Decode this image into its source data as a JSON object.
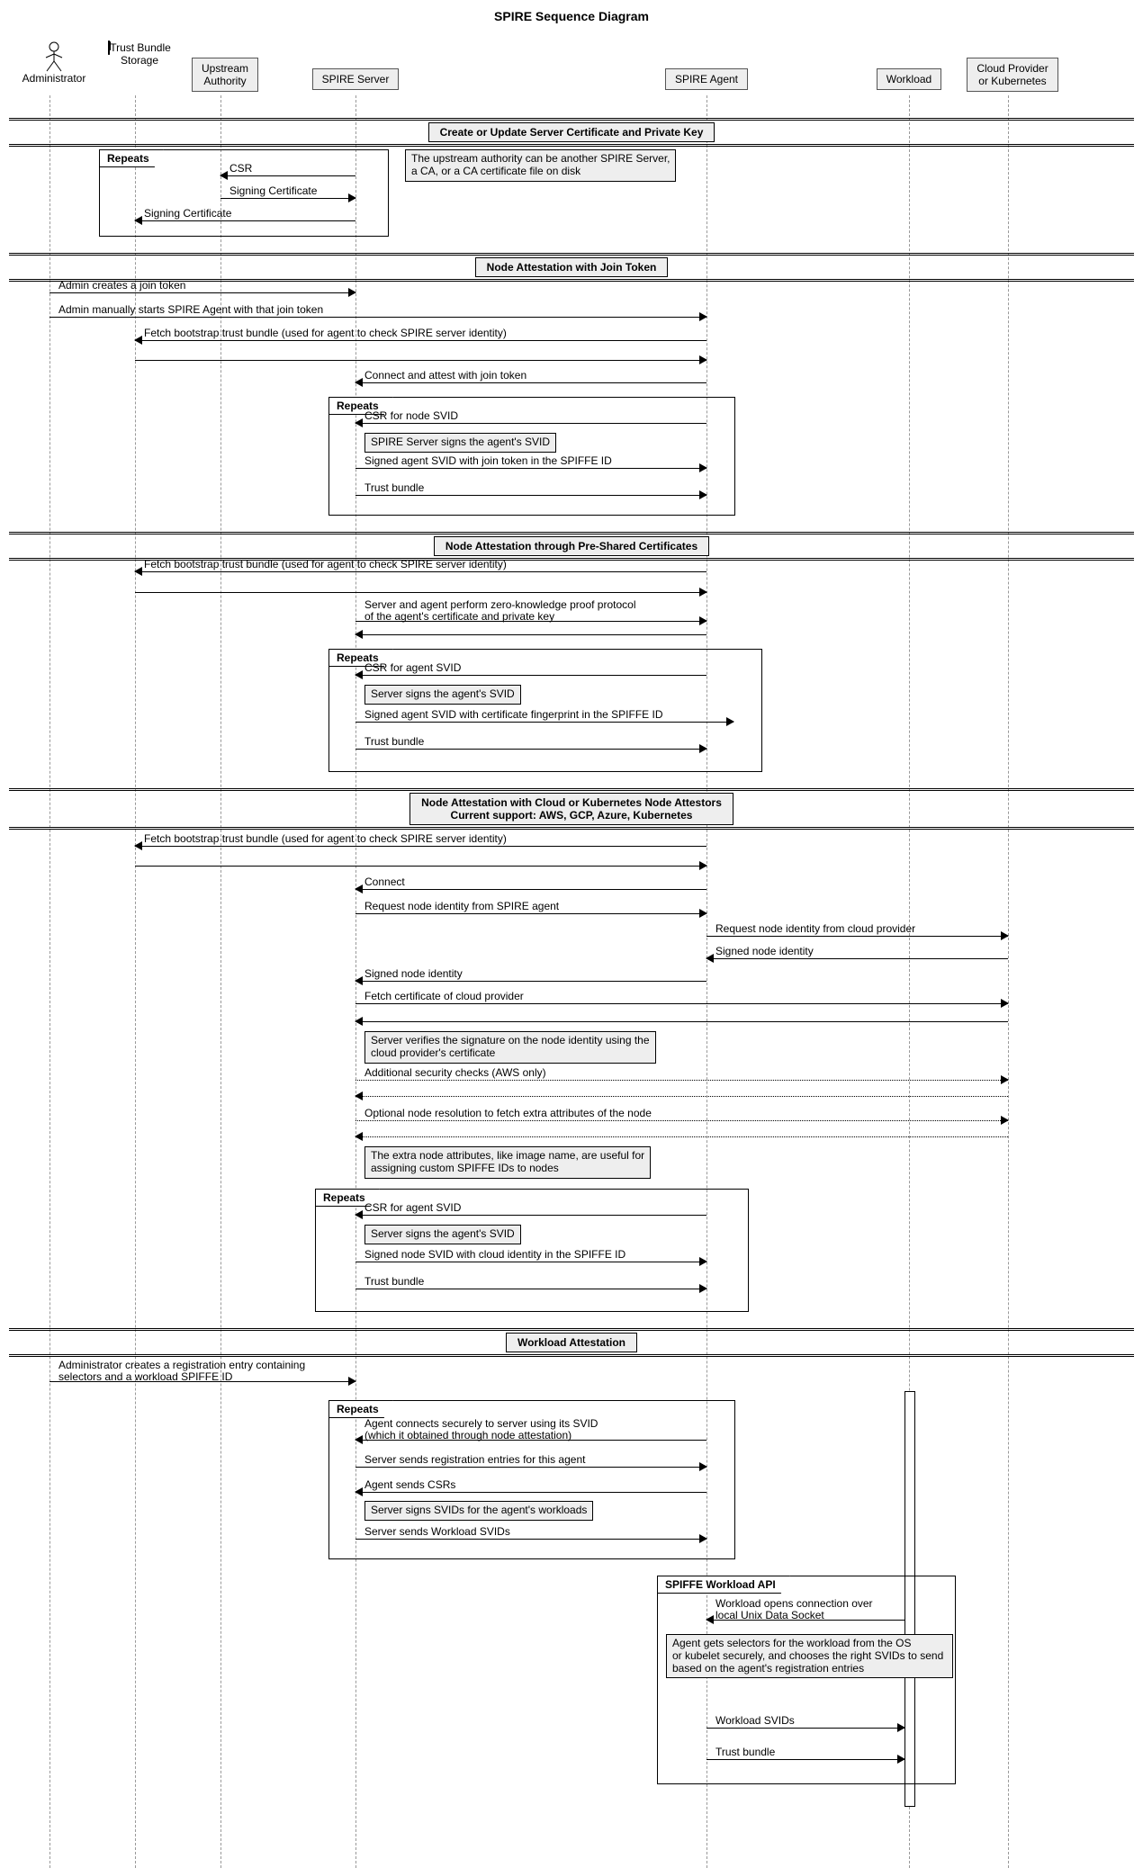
{
  "title": "SPIRE Sequence Diagram",
  "participants": {
    "admin": "Administrator",
    "storage": "Trust Bundle\nStorage",
    "upstream": "Upstream\nAuthority",
    "server": "SPIRE Server",
    "agent": "SPIRE Agent",
    "workload": "Workload",
    "cloud": "Cloud Provider\nor Kubernetes"
  },
  "sections": {
    "s1": "Create or Update Server Certificate and Private Key",
    "s2": "Node Attestation with Join Token",
    "s3": "Node Attestation through Pre-Shared Certificates",
    "s4": "Node Attestation with Cloud or Kubernetes Node Attestors\nCurrent support: AWS, GCP, Azure, Kubernetes",
    "s5": "Workload Attestation"
  },
  "loops": {
    "repeats": "Repeats",
    "spiffe_api": "SPIFFE Workload API"
  },
  "notes": {
    "upstream_note": "The upstream authority can be another SPIRE Server,\na CA, or a CA certificate file on disk",
    "sign_svid": "SPIRE Server signs the agent's SVID",
    "server_signs": "Server signs the agent's SVID",
    "verify_sig": "Server verifies the signature on the node identity using the\ncloud provider's certificate",
    "extra_attrs": "The extra node attributes, like image name, are useful for\nassigning custom SPIFFE IDs to nodes",
    "sign_workload": "Server signs SVIDs for the agent's workloads",
    "agent_selectors": "Agent gets selectors for the workload from the OS\nor kubelet securely, and chooses the right SVIDs to send\nbased on the agent's registration entries"
  },
  "messages": {
    "csr": "CSR",
    "signing_cert": "Signing Certificate",
    "signing_cert2": "Signing Certificate",
    "admin_join": "Admin creates a join token",
    "admin_start": "Admin manually starts SPIRE Agent with that join token",
    "fetch_bootstrap": "Fetch bootstrap trust bundle (used for agent to check SPIRE server identity)",
    "blank": " ",
    "connect_attest": "Connect and attest with join token",
    "csr_node": "CSR for node SVID",
    "signed_join": "Signed agent SVID with join token in the SPIFFE ID",
    "trust_bundle": "Trust bundle",
    "zero_knowledge": "Server and agent perform zero-knowledge proof protocol\nof the agent's certificate and private key",
    "csr_agent": "CSR for agent SVID",
    "signed_fp": "Signed agent SVID with certificate fingerprint in the SPIFFE ID",
    "connect": "Connect",
    "req_identity_agent": "Request node identity from SPIRE agent",
    "req_identity_cloud": "Request node identity from cloud provider",
    "signed_identity": "Signed node identity",
    "fetch_cloud_cert": "Fetch certificate of cloud provider",
    "addl_checks": "Additional security checks (AWS only)",
    "node_resolution": "Optional node resolution to fetch extra attributes of the node",
    "signed_cloud": "Signed node SVID with cloud identity in the SPIFFE ID",
    "admin_reg": "Administrator creates a registration entry containing\nselectors and a workload SPIFFE ID",
    "agent_connect": "Agent connects securely to server using its SVID\n(which it obtained through node attestation)",
    "server_reg": "Server sends registration entries for this agent",
    "agent_csrs": "Agent sends CSRs",
    "server_workload_svids": "Server sends Workload SVIDs",
    "workload_open": "Workload opens connection over\nlocal Unix Data Socket",
    "workload_svids": "Workload SVIDs",
    "trust_bundle2": "Trust bundle"
  },
  "chart_data": {
    "type": "sequence-diagram",
    "participants": [
      "Administrator",
      "Trust Bundle Storage",
      "Upstream Authority",
      "SPIRE Server",
      "SPIRE Agent",
      "Workload",
      "Cloud Provider or Kubernetes"
    ],
    "groups": [
      {
        "title": "Create or Update Server Certificate and Private Key",
        "loop": "Repeats",
        "note_right_of": {
          "participant": "SPIRE Server",
          "text": "The upstream authority can be another SPIRE Server, a CA, or a CA certificate file on disk"
        },
        "messages": [
          {
            "from": "SPIRE Server",
            "to": "Upstream Authority",
            "text": "CSR"
          },
          {
            "from": "Upstream Authority",
            "to": "SPIRE Server",
            "text": "Signing Certificate"
          },
          {
            "from": "SPIRE Server",
            "to": "Trust Bundle Storage",
            "text": "Signing Certificate"
          }
        ]
      },
      {
        "title": "Node Attestation with Join Token",
        "messages": [
          {
            "from": "Administrator",
            "to": "SPIRE Server",
            "text": "Admin creates a join token"
          },
          {
            "from": "Administrator",
            "to": "SPIRE Agent",
            "text": "Admin manually starts SPIRE Agent with that join token"
          },
          {
            "from": "SPIRE Agent",
            "to": "Trust Bundle Storage",
            "text": "Fetch bootstrap trust bundle (used for agent to check SPIRE server identity)"
          },
          {
            "from": "Trust Bundle Storage",
            "to": "SPIRE Agent",
            "text": ""
          },
          {
            "from": "SPIRE Agent",
            "to": "SPIRE Server",
            "text": "Connect and attest with join token"
          }
        ],
        "loop": {
          "label": "Repeats",
          "messages": [
            {
              "from": "SPIRE Agent",
              "to": "SPIRE Server",
              "text": "CSR for node SVID"
            },
            {
              "note_over": "SPIRE Server",
              "text": "SPIRE Server signs the agent's SVID"
            },
            {
              "from": "SPIRE Server",
              "to": "SPIRE Agent",
              "text": "Signed agent SVID with join token in the SPIFFE ID"
            },
            {
              "from": "SPIRE Server",
              "to": "SPIRE Agent",
              "text": "Trust bundle"
            }
          ]
        }
      },
      {
        "title": "Node Attestation through Pre-Shared Certificates",
        "messages": [
          {
            "from": "SPIRE Agent",
            "to": "Trust Bundle Storage",
            "text": "Fetch bootstrap trust bundle (used for agent to check SPIRE server identity)"
          },
          {
            "from": "Trust Bundle Storage",
            "to": "SPIRE Agent",
            "text": ""
          },
          {
            "from": "SPIRE Agent",
            "to": "SPIRE Server",
            "text": "Server and agent perform zero-knowledge proof protocol of the agent's certificate and private key",
            "bidirectional": true
          }
        ],
        "loop": {
          "label": "Repeats",
          "messages": [
            {
              "from": "SPIRE Agent",
              "to": "SPIRE Server",
              "text": "CSR for agent SVID"
            },
            {
              "note_over": "SPIRE Server",
              "text": "Server signs the agent's SVID"
            },
            {
              "from": "SPIRE Server",
              "to": "SPIRE Agent",
              "text": "Signed agent SVID with certificate fingerprint in the SPIFFE ID"
            },
            {
              "from": "SPIRE Server",
              "to": "SPIRE Agent",
              "text": "Trust bundle"
            }
          ]
        }
      },
      {
        "title": "Node Attestation with Cloud or Kubernetes Node Attestors — Current support: AWS, GCP, Azure, Kubernetes",
        "messages": [
          {
            "from": "SPIRE Agent",
            "to": "Trust Bundle Storage",
            "text": "Fetch bootstrap trust bundle (used for agent to check SPIRE server identity)"
          },
          {
            "from": "Trust Bundle Storage",
            "to": "SPIRE Agent",
            "text": ""
          },
          {
            "from": "SPIRE Agent",
            "to": "SPIRE Server",
            "text": "Connect"
          },
          {
            "from": "SPIRE Server",
            "to": "SPIRE Agent",
            "text": "Request node identity from SPIRE agent"
          },
          {
            "from": "SPIRE Agent",
            "to": "Cloud Provider or Kubernetes",
            "text": "Request node identity from cloud provider"
          },
          {
            "from": "Cloud Provider or Kubernetes",
            "to": "SPIRE Agent",
            "text": "Signed node identity"
          },
          {
            "from": "SPIRE Agent",
            "to": "SPIRE Server",
            "text": "Signed node identity"
          },
          {
            "from": "SPIRE Server",
            "to": "Cloud Provider or Kubernetes",
            "text": "Fetch certificate of cloud provider"
          },
          {
            "from": "Cloud Provider or Kubernetes",
            "to": "SPIRE Server",
            "text": ""
          },
          {
            "note_over": "SPIRE Server",
            "text": "Server verifies the signature on the node identity using the cloud provider's certificate"
          },
          {
            "from": "SPIRE Server",
            "to": "Cloud Provider or Kubernetes",
            "text": "Additional security checks (AWS only)",
            "style": "dotted",
            "bidirectional": true
          },
          {
            "from": "SPIRE Server",
            "to": "Cloud Provider or Kubernetes",
            "text": "Optional node resolution to fetch extra attributes of the node",
            "style": "dotted",
            "bidirectional": true
          },
          {
            "note_over": "SPIRE Server",
            "text": "The extra node attributes, like image name, are useful for assigning custom SPIFFE IDs to nodes"
          }
        ],
        "loop": {
          "label": "Repeats",
          "messages": [
            {
              "from": "SPIRE Agent",
              "to": "SPIRE Server",
              "text": "CSR for agent SVID"
            },
            {
              "note_over": "SPIRE Server",
              "text": "Server signs the agent's SVID"
            },
            {
              "from": "SPIRE Server",
              "to": "SPIRE Agent",
              "text": "Signed node SVID with cloud identity in the SPIFFE ID"
            },
            {
              "from": "SPIRE Server",
              "to": "SPIRE Agent",
              "text": "Trust bundle"
            }
          ]
        }
      },
      {
        "title": "Workload Attestation",
        "messages": [
          {
            "from": "Administrator",
            "to": "SPIRE Server",
            "text": "Administrator creates a registration entry containing selectors and a workload SPIFFE ID"
          }
        ],
        "loop": {
          "label": "Repeats",
          "messages": [
            {
              "from": "SPIRE Agent",
              "to": "SPIRE Server",
              "text": "Agent connects securely to server using its SVID (which it obtained through node attestation)"
            },
            {
              "from": "SPIRE Server",
              "to": "SPIRE Agent",
              "text": "Server sends registration entries for this agent"
            },
            {
              "from": "SPIRE Agent",
              "to": "SPIRE Server",
              "text": "Agent sends CSRs"
            },
            {
              "note_over": "SPIRE Server",
              "text": "Server signs SVIDs for the agent's workloads"
            },
            {
              "from": "SPIRE Server",
              "to": "SPIRE Agent",
              "text": "Server sends Workload SVIDs"
            }
          ]
        },
        "inner_group": {
          "label": "SPIFFE Workload API",
          "messages": [
            {
              "from": "Workload",
              "to": "SPIRE Agent",
              "text": "Workload opens connection over local Unix Data Socket"
            },
            {
              "note_over": "SPIRE Agent",
              "text": "Agent gets selectors for the workload from the OS or kubelet securely, and chooses the right SVIDs to send based on the agent's registration entries"
            },
            {
              "from": "SPIRE Agent",
              "to": "Workload",
              "text": "Workload SVIDs"
            },
            {
              "from": "SPIRE Agent",
              "to": "Workload",
              "text": "Trust bundle"
            }
          ]
        }
      }
    ]
  }
}
